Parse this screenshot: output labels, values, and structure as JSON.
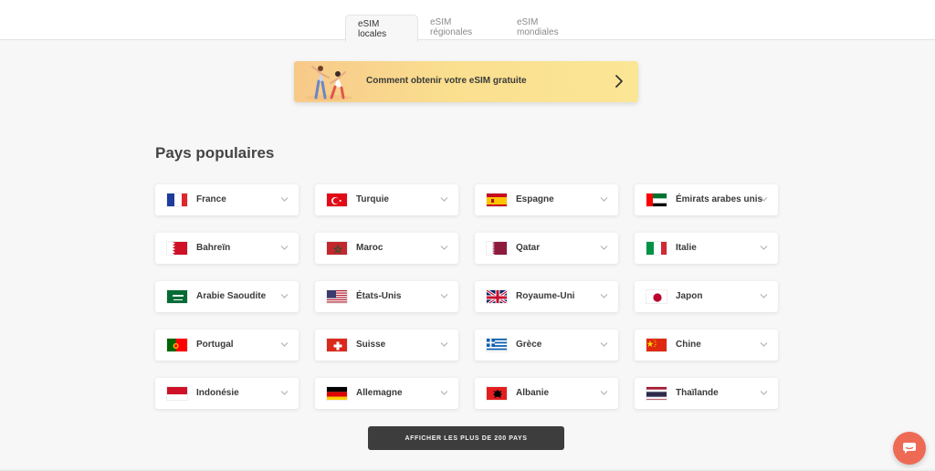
{
  "tabs": [
    {
      "label": "eSIM locales",
      "active": true
    },
    {
      "label": "eSIM régionales",
      "active": false
    },
    {
      "label": "eSIM mondiales",
      "active": false
    }
  ],
  "promo": {
    "text": "Comment obtenir votre eSIM gratuite",
    "arrow_icon": "chevron-right-icon",
    "gradient": [
      "#f7c98a",
      "#fbe696"
    ]
  },
  "section_title": "Pays populaires",
  "countries": [
    {
      "name": "France",
      "flag": "france"
    },
    {
      "name": "Turquie",
      "flag": "turkey"
    },
    {
      "name": "Espagne",
      "flag": "spain"
    },
    {
      "name": "Émirats arabes unis",
      "flag": "uae"
    },
    {
      "name": "Bahreïn",
      "flag": "bahrain"
    },
    {
      "name": "Maroc",
      "flag": "morocco"
    },
    {
      "name": "Qatar",
      "flag": "qatar"
    },
    {
      "name": "Italie",
      "flag": "italy"
    },
    {
      "name": "Arabie Saoudite",
      "flag": "saudi-arabia"
    },
    {
      "name": "États-Unis",
      "flag": "usa"
    },
    {
      "name": "Royaume-Uni",
      "flag": "uk"
    },
    {
      "name": "Japon",
      "flag": "japan"
    },
    {
      "name": "Portugal",
      "flag": "portugal"
    },
    {
      "name": "Suisse",
      "flag": "switzerland"
    },
    {
      "name": "Grèce",
      "flag": "greece"
    },
    {
      "name": "Chine",
      "flag": "china"
    },
    {
      "name": "Indonésie",
      "flag": "indonesia"
    },
    {
      "name": "Allemagne",
      "flag": "germany"
    },
    {
      "name": "Albanie",
      "flag": "albania"
    },
    {
      "name": "Thaïlande",
      "flag": "thailand"
    }
  ],
  "show_all_label": "AFFICHER LES PLUS DE 200 PAYS",
  "chat_icon": "chat-bubble-icon",
  "colors": {
    "button_dark": "#3d3d3d",
    "chat_accent": "#ee6a55"
  }
}
